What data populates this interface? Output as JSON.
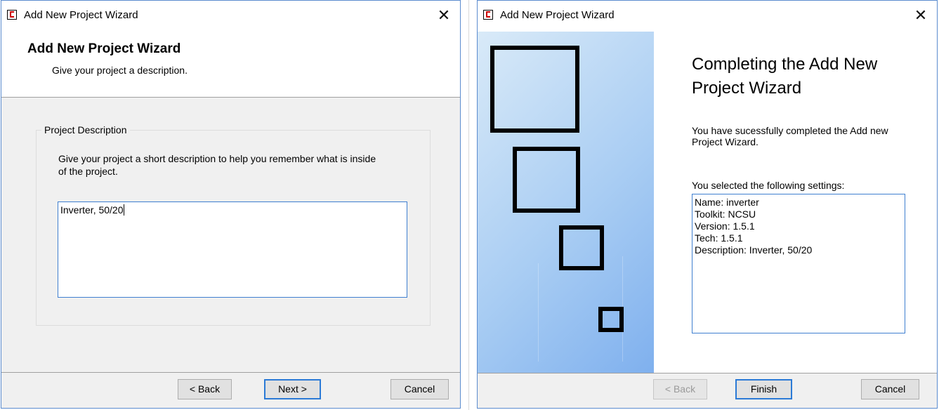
{
  "left_window": {
    "title": "Add New Project Wizard",
    "header_title": "Add New Project Wizard",
    "header_subtitle": "Give your project a description.",
    "group_label": "Project Description",
    "group_text": "Give your project a short description to help you remember what is inside of the project.",
    "description_value": "Inverter, 50/20",
    "buttons": {
      "back": "< Back",
      "next": "Next >",
      "cancel": "Cancel"
    }
  },
  "right_window": {
    "title": "Add New Project Wizard",
    "heading": "Completing the Add New Project Wizard",
    "message": "You have sucessfully completed the Add new Project Wizard.",
    "settings_label": "You selected the following settings:",
    "settings": [
      "Name: inverter",
      "Toolkit: NCSU",
      "Version: 1.5.1",
      "Tech: 1.5.1",
      "Description: Inverter, 50/20"
    ],
    "buttons": {
      "back": "< Back",
      "finish": "Finish",
      "cancel": "Cancel"
    }
  },
  "icons": {
    "close": "close-icon",
    "app": "app-icon"
  },
  "colors": {
    "accent_border": "#2b7ad6",
    "panel_gradient_start": "#d9eaf8",
    "panel_gradient_end": "#7fb0ee"
  }
}
